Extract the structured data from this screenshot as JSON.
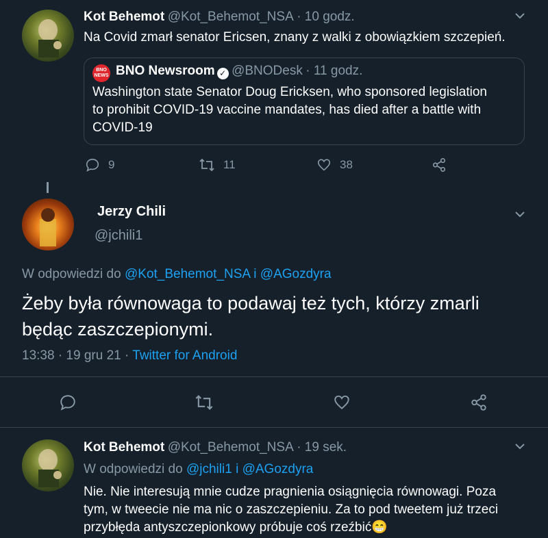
{
  "tweet1": {
    "display_name": "Kot Behemot",
    "handle": "@Kot_Behemot_NSA",
    "time": "· 10 godz.",
    "text": "Na Covid zmarł senator Ericsen, znany z walki z obowiązkiem szczepień.",
    "quote": {
      "logo_text": "BNO NEWS",
      "display_name": "BNO Newsroom",
      "handle": "@BNODesk",
      "time": "· 11 godz.",
      "text_lines": [
        "Washington state Senator Doug Ericksen, who sponsored legislation",
        "to prohibit COVID-19 vaccine mandates, has died after a battle with",
        "COVID-19"
      ]
    },
    "replies": "9",
    "retweets": "11",
    "likes": "38"
  },
  "tweet2": {
    "display_name": "Jerzy Chili",
    "handle": "@jchili1",
    "reply_prefix": "W odpowiedzi do",
    "reply_to_1": "@Kot_Behemot_NSA",
    "reply_join": "i",
    "reply_to_2": "@AGozdyra",
    "text_lines": [
      "Żeby była równowaga to podawaj też tych, którzy zmarli",
      "będąc zaszczepionymi."
    ],
    "timestamp": "13:38 · 19 gru 21 ·",
    "source": "Twitter for Android"
  },
  "tweet3": {
    "display_name": "Kot Behemot",
    "handle": "@Kot_Behemot_NSA",
    "time": "· 19 sek.",
    "reply_prefix": "W odpowiedzi do",
    "reply_to_1": "@jchili1",
    "reply_join": "i",
    "reply_to_2": "@AGozdyra",
    "text_lines": [
      "Nie. Nie interesują mnie cudze pragnienia osiągnięcia równowagi. Poza",
      "tym, w tweecie nie ma nic o zaszczepieniu. Za to pod tweetem już trzeci",
      "przybłęda antyszczepionkowy próbuje coś rzeźbić😁"
    ]
  },
  "colors": {
    "background": "#15202b",
    "muted": "#8899a6",
    "link": "#1da1f2",
    "border": "#38444d"
  }
}
